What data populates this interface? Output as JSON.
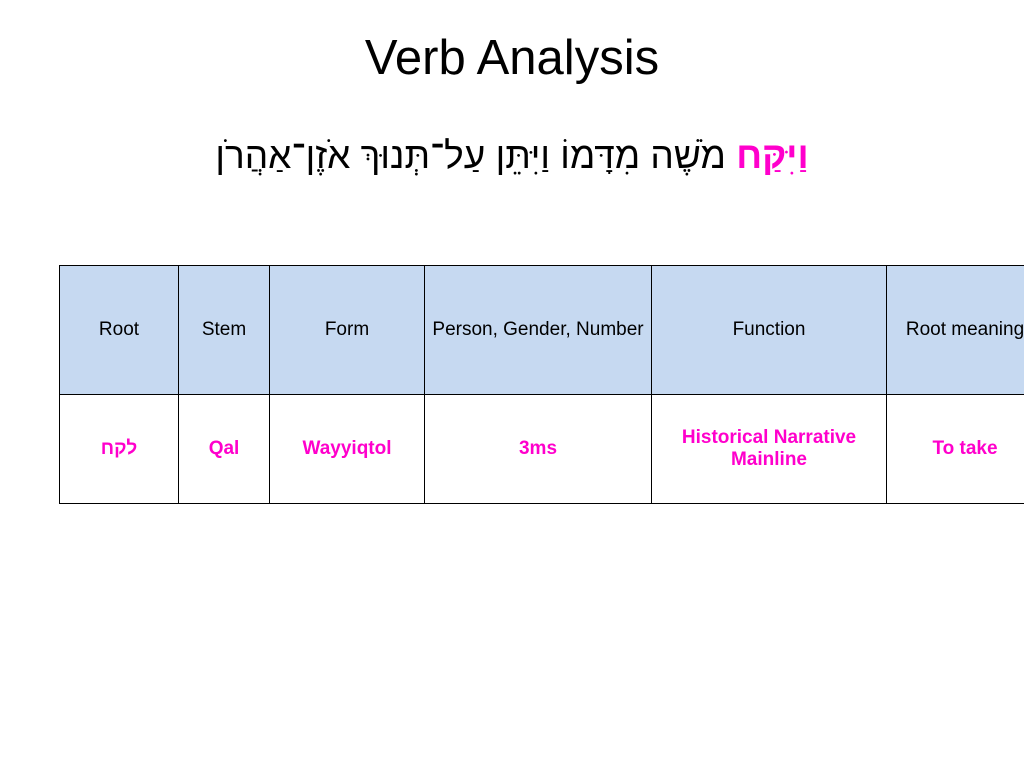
{
  "slide": {
    "title": "Verb Analysis",
    "verse": {
      "highlighted_word": "וַיִּקַּח",
      "rest": " מֹשֶׁה מִדָּמוֹ וַיִּתֵּן עַל־תְּנוּךְ אֹזֶן־אַהֲרֹן"
    },
    "accent_color": "#ff00cc",
    "header_bg": "#c6d9f1"
  },
  "table": {
    "headers": [
      "Root",
      "Stem",
      "Form",
      "Person, Gender, Number",
      "Function",
      "Root meaning"
    ],
    "rows": [
      {
        "root": "לקח",
        "stem": "Qal",
        "form": "Wayyiqtol",
        "pgn": "3ms",
        "function": "Historical Narrative Mainline",
        "root_meaning": "To take"
      }
    ]
  }
}
